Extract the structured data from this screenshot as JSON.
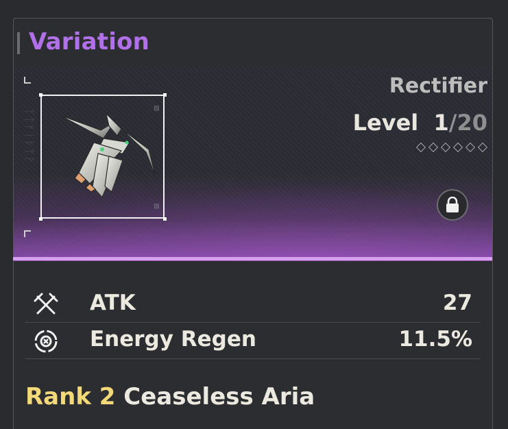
{
  "header": {
    "title": "Variation"
  },
  "weapon": {
    "type": "Rectifier",
    "level_label": "Level",
    "level_current": "1",
    "level_max": "/20",
    "rank_diamonds": 6,
    "locked": true,
    "icon": "rectifier-weapon-icon"
  },
  "stats": [
    {
      "icon": "crossed-swords-icon",
      "label": "ATK",
      "value": "27"
    },
    {
      "icon": "energy-regen-icon",
      "label": "Energy Regen",
      "value": "11.5%"
    }
  ],
  "passive": {
    "rank": "Rank 2",
    "name": "Ceaseless Aria"
  },
  "colors": {
    "title": "#b070e8",
    "rank": "#f3d97a",
    "banner_glow": "#d7a0ee",
    "text": "#ece9e0"
  }
}
